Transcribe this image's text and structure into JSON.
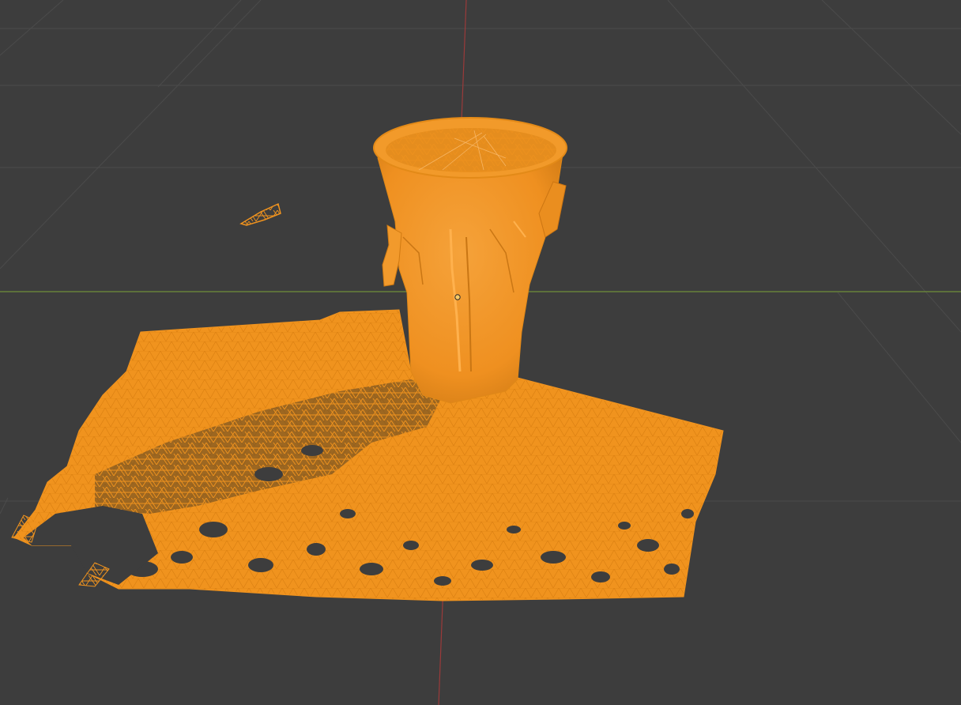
{
  "viewport": {
    "background_color": "#3d3d3d",
    "grid_color": "#4b4b4b",
    "x_axis_color": "#6f8f3a",
    "y_axis_color": "#9a3a3a",
    "selection_color": "#f0931e",
    "selection_edge_color": "#ffb347",
    "origin_color": "#ffcc66"
  },
  "scene": {
    "selected_object": "scanned-mesh",
    "display_mode": "wireframe-over-solid",
    "mesh_parts": [
      "goblet-head-vessel",
      "ground-patch",
      "floating-fragment"
    ]
  }
}
